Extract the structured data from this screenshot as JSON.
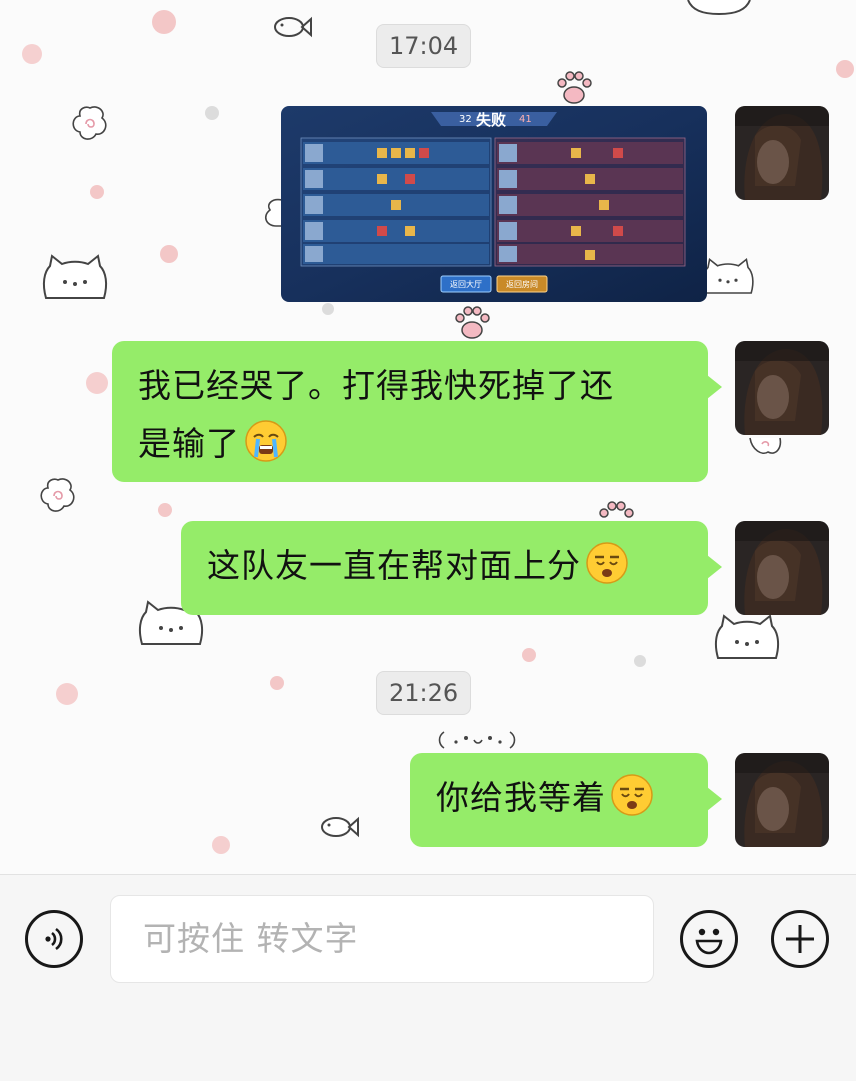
{
  "chat": {
    "time_stamps": [
      "17:04",
      "21:26"
    ],
    "messages": [
      {
        "type": "image",
        "sender": "me",
        "description_labels": {
          "left_score": "32",
          "result": "失败",
          "right_score": "41",
          "btn_lobby": "返回大厅",
          "btn_room": "返回房间"
        }
      },
      {
        "type": "text",
        "sender": "me",
        "line1": "我已经哭了。打得我快死掉了还",
        "line2": "是输了",
        "emoji": "crying-face"
      },
      {
        "type": "text",
        "sender": "me",
        "text": "这队友一直在帮对面上分",
        "emoji": "unamused-face"
      },
      {
        "type": "text",
        "sender": "me",
        "text": "你给我等着",
        "emoji": "unamused-face"
      }
    ]
  },
  "input_bar": {
    "placeholder": "可按住 转文字",
    "voice_icon": "voice-icon",
    "emoji_icon": "emoji-icon",
    "plus_icon": "plus-icon"
  },
  "colors": {
    "bubble": "#95ec69",
    "background": "#fbfbfb"
  }
}
